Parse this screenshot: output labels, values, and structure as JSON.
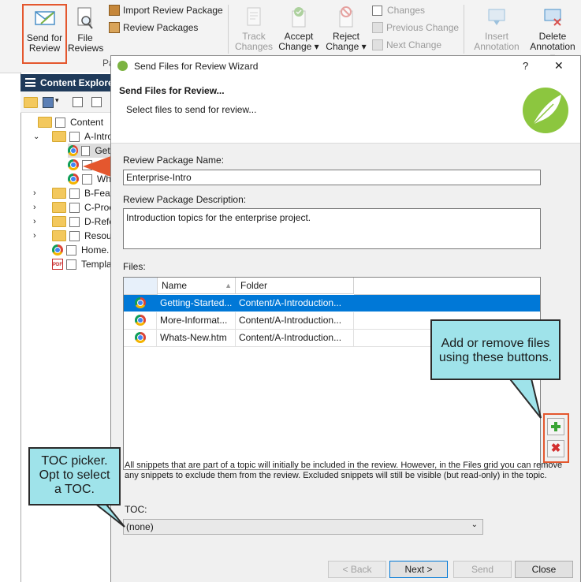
{
  "ribbon": {
    "send_for_review": [
      "Send for",
      "Review"
    ],
    "file_reviews": [
      "File",
      "Reviews"
    ],
    "import_review_package": "Import Review Package",
    "review_packages": "Review Packages",
    "group_label_partial": "Pa",
    "track_changes": [
      "Track",
      "Changes"
    ],
    "accept_change": [
      "Accept",
      "Change ▾"
    ],
    "reject_change": [
      "Reject",
      "Change ▾"
    ],
    "changes": "Changes",
    "previous_change": "Previous Change",
    "next_change": "Next Change",
    "insert_annotation": [
      "Insert",
      "Annotation"
    ],
    "delete_annotation": [
      "Delete",
      "Annotation ▾"
    ]
  },
  "explorer": {
    "title": "Content Explore",
    "items": [
      {
        "label": "Content",
        "icon": "folder-icon"
      },
      {
        "label": "A-Intro",
        "icon": "folder-icon"
      },
      {
        "label": "Gett",
        "icon": "chrome-icon"
      },
      {
        "label": "",
        "icon": "chrome-icon"
      },
      {
        "label": "Wh",
        "icon": "chrome-icon"
      },
      {
        "label": "B-Feat",
        "icon": "folder-icon"
      },
      {
        "label": "C-Proc",
        "icon": "folder-icon"
      },
      {
        "label": "D-Refe",
        "icon": "folder-icon"
      },
      {
        "label": "Resour",
        "icon": "folder-icon"
      },
      {
        "label": "Home.",
        "icon": "chrome-icon"
      },
      {
        "label": "Templa",
        "icon": "pdf-icon"
      }
    ]
  },
  "dialog": {
    "title": "Send Files for Review Wizard",
    "help": "?",
    "close": "✕",
    "heading": "Send Files for Review...",
    "subheading": "Select files to send for review...",
    "package_name_label": "Review Package Name:",
    "package_name_value": "Enterprise-Intro",
    "package_desc_label": "Review Package Description:",
    "package_desc_value": "Introduction topics for the enterprise project.",
    "files_label": "Files:",
    "columns": [
      "Name",
      "Folder"
    ],
    "files": [
      {
        "name": "Getting-Started...",
        "folder": "Content/A-Introduction..."
      },
      {
        "name": "More-Informat...",
        "folder": "Content/A-Introduction..."
      },
      {
        "name": "Whats-New.htm",
        "folder": "Content/A-Introduction..."
      }
    ],
    "snippet_note": "All snippets that are part of a topic will initially be included in the review. However, in the Files grid you can remove any snippets to exclude them from the review. Excluded snippets will still be visible (but read-only) in the topic.",
    "toc_label": "TOC:",
    "toc_value": "(none)",
    "back": "< Back",
    "next": "Next >",
    "send": "Send",
    "close_button": "Close"
  },
  "callouts": {
    "files": "Add or remove files using these buttons.",
    "toc": "TOC picker. Opt to select a TOC."
  },
  "colors": {
    "accent_red": "#e4572e",
    "callout": "#9fe3ea",
    "selection": "#0078d7",
    "explorer_title": "#1f3a5a"
  }
}
